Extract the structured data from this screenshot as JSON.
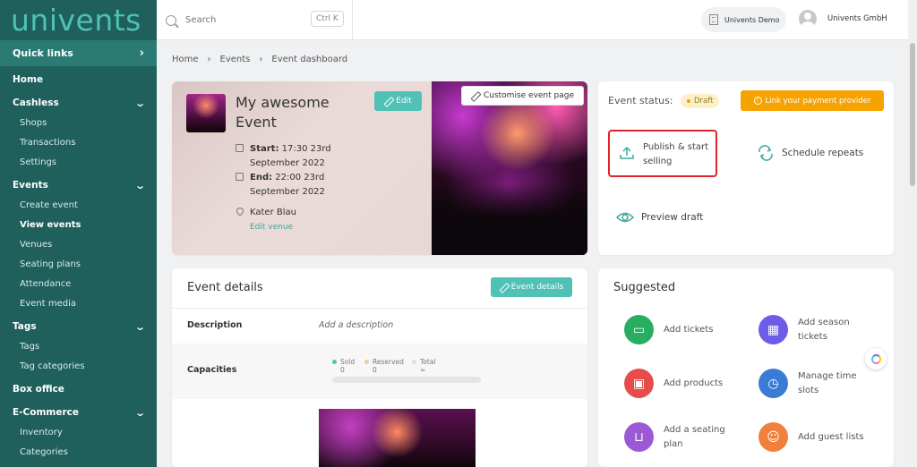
{
  "app": {
    "logo": "univents"
  },
  "sidebar": {
    "quick_links": "Quick links",
    "home": "Home",
    "cashless": {
      "label": "Cashless",
      "items": [
        "Shops",
        "Transactions",
        "Settings"
      ]
    },
    "events": {
      "label": "Events",
      "items": [
        "Create event",
        "View events",
        "Venues",
        "Seating plans",
        "Attendance",
        "Event media"
      ]
    },
    "tags": {
      "label": "Tags",
      "items": [
        "Tags",
        "Tag categories"
      ]
    },
    "box_office": "Box office",
    "ecommerce": {
      "label": "E-Commerce",
      "items": [
        "Inventory",
        "Categories"
      ]
    }
  },
  "topbar": {
    "search_placeholder": "Search",
    "shortcut": "Ctrl K",
    "org": "Univents Demo",
    "user": "Univents GmbH"
  },
  "breadcrumb": [
    "Home",
    "Events",
    "Event dashboard"
  ],
  "event": {
    "title": "My awesome Event",
    "edit": "Edit",
    "customise": "Customise event page",
    "start_label": "Start:",
    "start_value": "17:30 23rd September 2022",
    "end_label": "End:",
    "end_value": "22:00 23rd September 2022",
    "venue": "Kater Blau",
    "edit_venue": "Edit venue"
  },
  "status": {
    "label": "Event status:",
    "badge": "Draft",
    "link_payment": "Link your payment provider",
    "publish": "Publish & start selling",
    "schedule": "Schedule repeats",
    "preview": "Preview draft"
  },
  "details": {
    "title": "Event details",
    "button": "Event details",
    "description_label": "Description",
    "description_value": "Add a description",
    "capacities_label": "Capacities",
    "caps": [
      {
        "label": "Sold",
        "value": "0",
        "color": "#4fc1b6"
      },
      {
        "label": "Reserved",
        "value": "0",
        "color": "#f5c89a"
      },
      {
        "label": "Total",
        "value": "∞",
        "color": "#e0e0e0"
      }
    ]
  },
  "suggested": {
    "title": "Suggested",
    "items": [
      {
        "label": "Add tickets",
        "color": "#27ae60",
        "icon": "ticket-icon"
      },
      {
        "label": "Add season tickets",
        "color": "#6c5ce7",
        "icon": "calendar-icon"
      },
      {
        "label": "Add products",
        "color": "#e74c4c",
        "icon": "box-icon"
      },
      {
        "label": "Manage time slots",
        "color": "#3a7bd5",
        "icon": "clock-icon"
      },
      {
        "label": "Add a seating plan",
        "color": "#9b59d6",
        "icon": "sofa-icon"
      },
      {
        "label": "Add guest lists",
        "color": "#f0803c",
        "icon": "user-icon"
      }
    ]
  }
}
